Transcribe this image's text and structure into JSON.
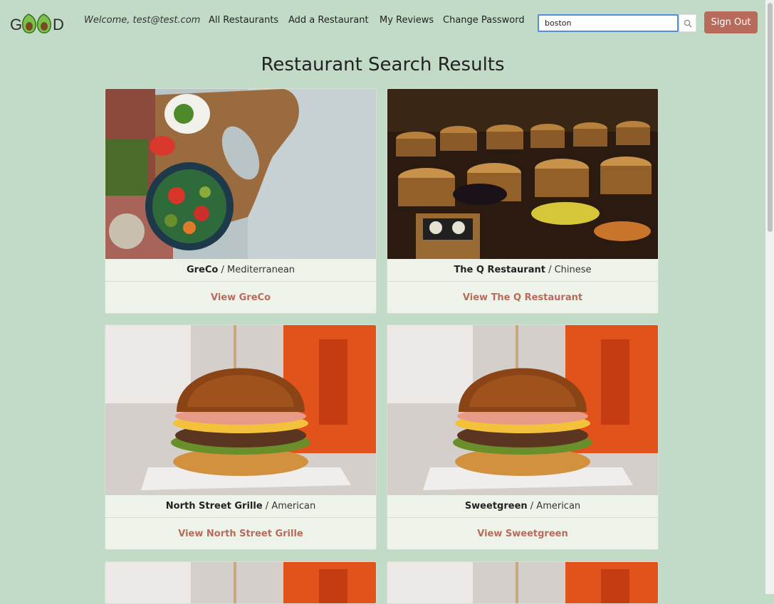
{
  "header": {
    "logo_text": "GOOD",
    "welcome": "Welcome, test@test.com",
    "nav": [
      "All Restaurants",
      "Add a Restaurant",
      "My Reviews",
      "Change Password"
    ],
    "search_value": "boston",
    "search_icon": "magnifier-icon",
    "signout_label": "Sign Out"
  },
  "main": {
    "title": "Restaurant Search Results",
    "cards": [
      {
        "name": "GreCo",
        "cuisine": "Mediterranean",
        "sep": " / ",
        "link": "View GreCo",
        "image": "mediterranean-food-photo"
      },
      {
        "name": "The Q Restaurant",
        "cuisine": "Chinese",
        "sep": " / ",
        "link": "View The Q Restaurant",
        "image": "dim-sum-steamer-photo"
      },
      {
        "name": "North Street Grille",
        "cuisine": "American",
        "sep": " / ",
        "link": "View North Street Grille",
        "image": "burger-photo"
      },
      {
        "name": "Sweetgreen",
        "cuisine": "American",
        "sep": " / ",
        "link": "View Sweetgreen",
        "image": "burger-photo"
      }
    ]
  },
  "colors": {
    "background": "#c2dbc6",
    "accent": "#b86a5b",
    "card": "#eef3ea"
  }
}
